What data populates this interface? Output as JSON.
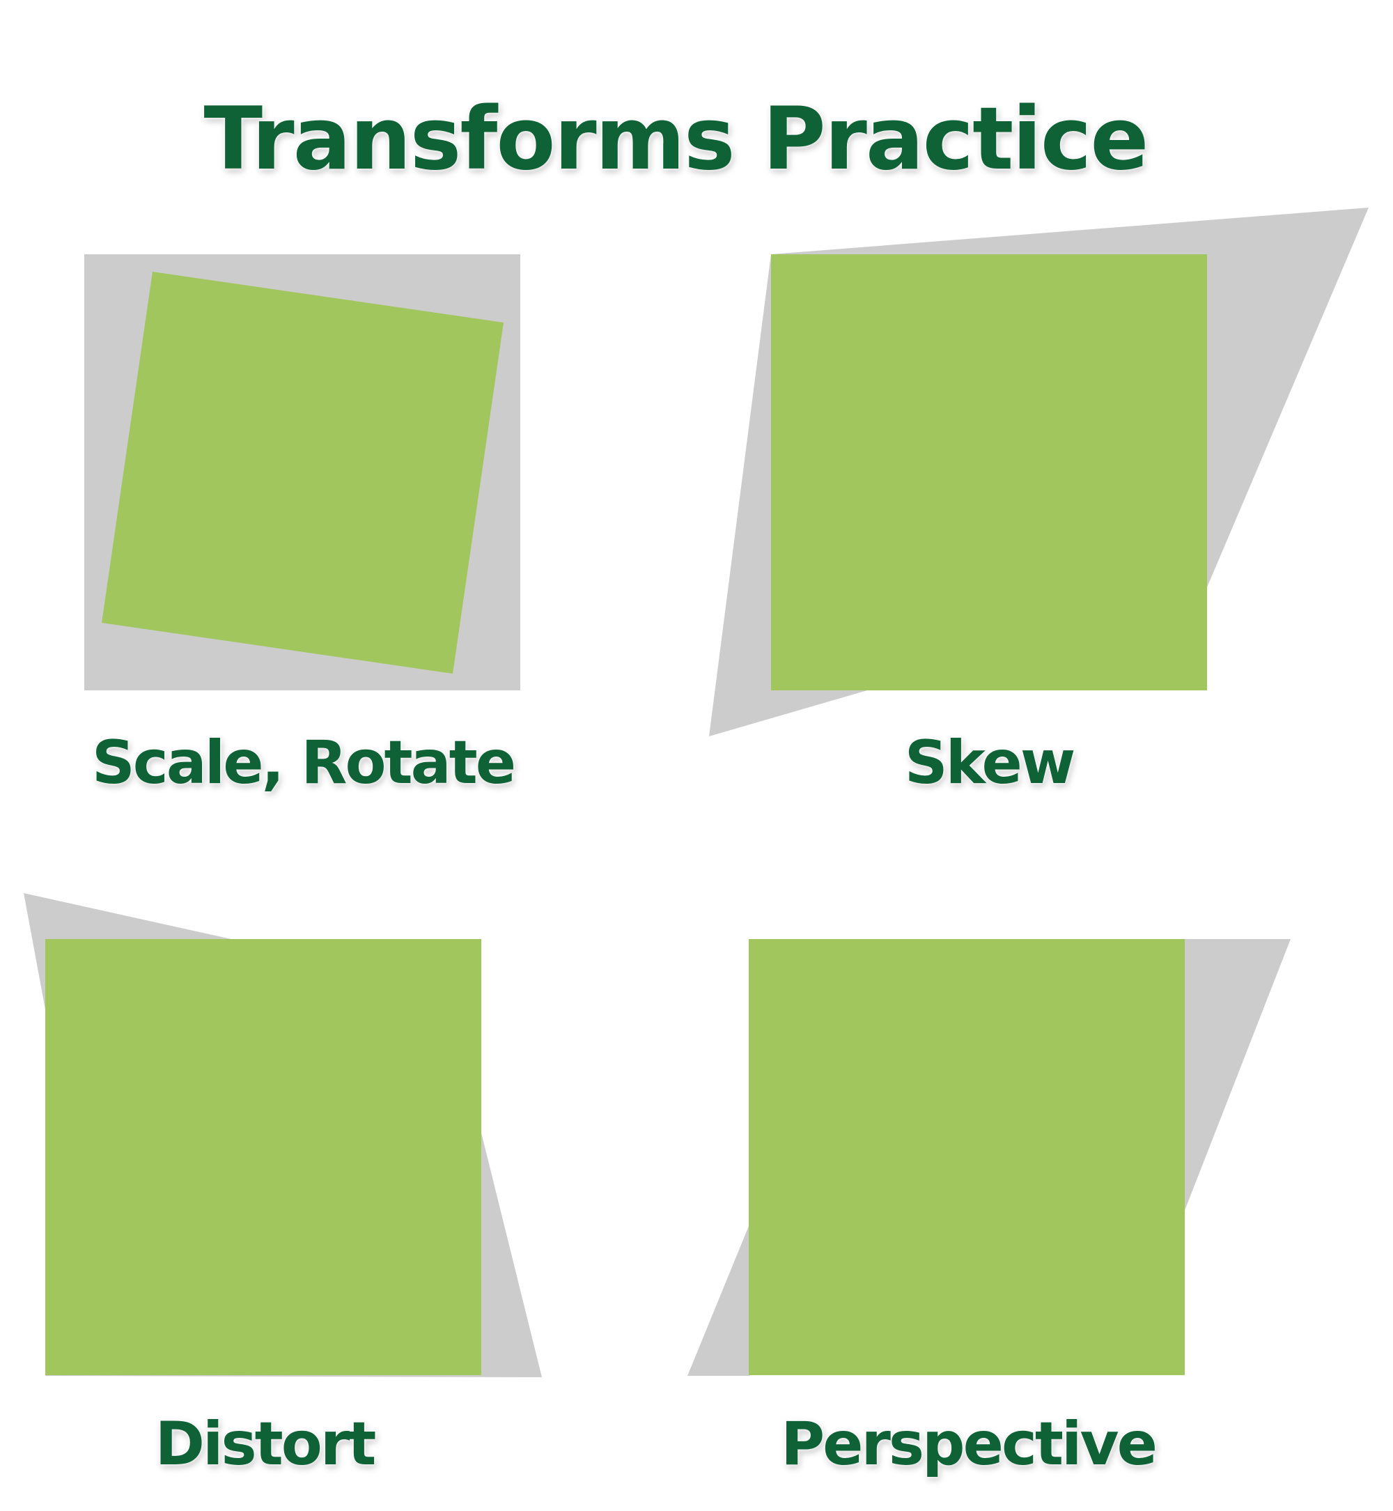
{
  "title": "Transforms Practice",
  "colors": {
    "title_text": "#0f6136",
    "square_fill": "#a2c65e",
    "shadow_fill": "#cccccc",
    "background": "#ffffff"
  },
  "panels": [
    {
      "id": "scale-rotate",
      "label": "Scale, Rotate"
    },
    {
      "id": "skew",
      "label": "Skew"
    },
    {
      "id": "distort",
      "label": "Distort"
    },
    {
      "id": "perspective",
      "label": "Perspective"
    }
  ]
}
